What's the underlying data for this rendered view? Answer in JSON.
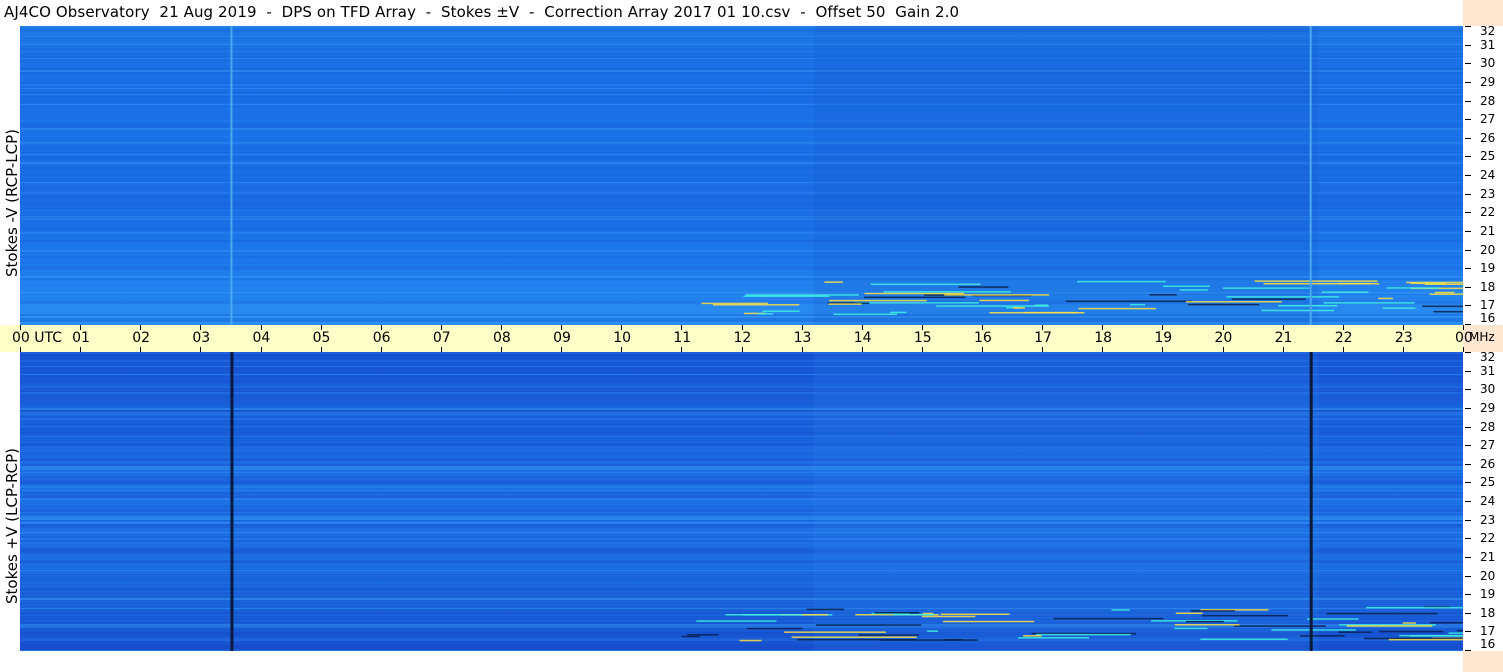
{
  "title": "AJ4CO Observatory  21 Aug 2019  -  DPS on TFD Array  -  Stokes ±V  -  Correction Array 2017 01 10.csv  -  Offset 50  Gain 2.0",
  "colors": {
    "time_axis_bg": "#ffffc8",
    "freq_axis_bg": "#ffe6d0",
    "background": "#1e72e6"
  },
  "chart_data": [
    {
      "type": "heatmap",
      "ylabel": "Stokes -V (RCP-LCP)",
      "x_ticks": [
        "00 UTC",
        "01",
        "02",
        "03",
        "04",
        "05",
        "06",
        "07",
        "08",
        "09",
        "10",
        "11",
        "12",
        "13",
        "14",
        "15",
        "16",
        "17",
        "18",
        "19",
        "20",
        "21",
        "22",
        "23",
        "00"
      ],
      "x_unit": "UTC",
      "xlim": [
        0,
        24
      ],
      "y_ticks": [
        "32",
        "31",
        "30",
        "29",
        "28",
        "27",
        "26",
        "25",
        "24",
        "23",
        "22",
        "21",
        "20",
        "19",
        "18",
        "17",
        "16"
      ],
      "ylim": [
        16,
        32
      ],
      "y_unit": "MHz",
      "vertical_lines_utc": [
        3.5,
        21.45
      ],
      "vertical_line_color": "#4aa8f0"
    },
    {
      "type": "heatmap",
      "ylabel": "Stokes +V (LCP-RCP)",
      "x_ticks": [
        "00 UTC",
        "01",
        "02",
        "03",
        "04",
        "05",
        "06",
        "07",
        "08",
        "09",
        "10",
        "11",
        "12",
        "13",
        "14",
        "15",
        "16",
        "17",
        "18",
        "19",
        "20",
        "21",
        "22",
        "23",
        "00"
      ],
      "x_unit": "UTC",
      "xlim": [
        0,
        24
      ],
      "y_ticks": [
        "32",
        "31",
        "30",
        "29",
        "28",
        "27",
        "26",
        "25",
        "24",
        "23",
        "22",
        "21",
        "20",
        "19",
        "18",
        "17",
        "16"
      ],
      "ylim": [
        16,
        32
      ],
      "y_unit": "MHz",
      "vertical_lines_utc": [
        3.5,
        21.45
      ],
      "vertical_line_color": "#0a1a3a"
    }
  ],
  "axis": {
    "mhz_label": "MHz"
  }
}
